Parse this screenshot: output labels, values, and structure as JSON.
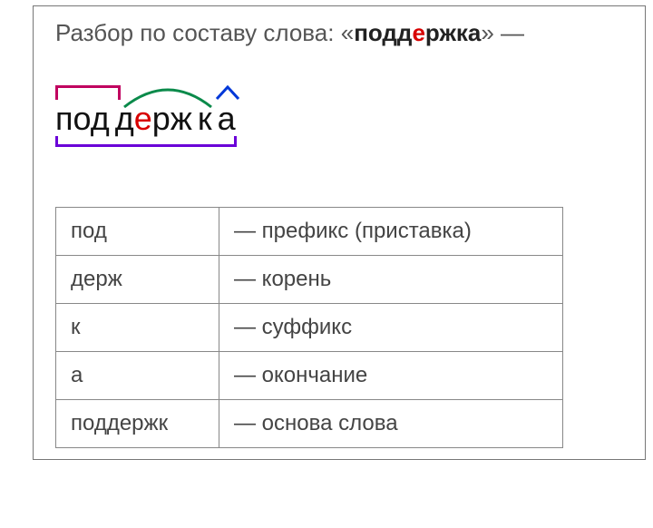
{
  "title": {
    "prefix_text": "Разбор по составу слова: «",
    "word_before_highlight": "подд",
    "word_highlight": "е",
    "word_after_highlight": "ржка",
    "suffix_text": "» —"
  },
  "diagram": {
    "p1": "под",
    "p2a": "д",
    "p2_highlight": "е",
    "p2b": "рж",
    "p3": "к",
    "p4": "а"
  },
  "table": {
    "rows": [
      {
        "morpheme": "под",
        "desc": "— префикс (приставка)"
      },
      {
        "morpheme": "держ",
        "desc": "— корень"
      },
      {
        "morpheme": "к",
        "desc": "— суффикс"
      },
      {
        "morpheme": "а",
        "desc": "— окончание"
      },
      {
        "morpheme": "поддержк",
        "desc": "— основа слова"
      }
    ]
  }
}
